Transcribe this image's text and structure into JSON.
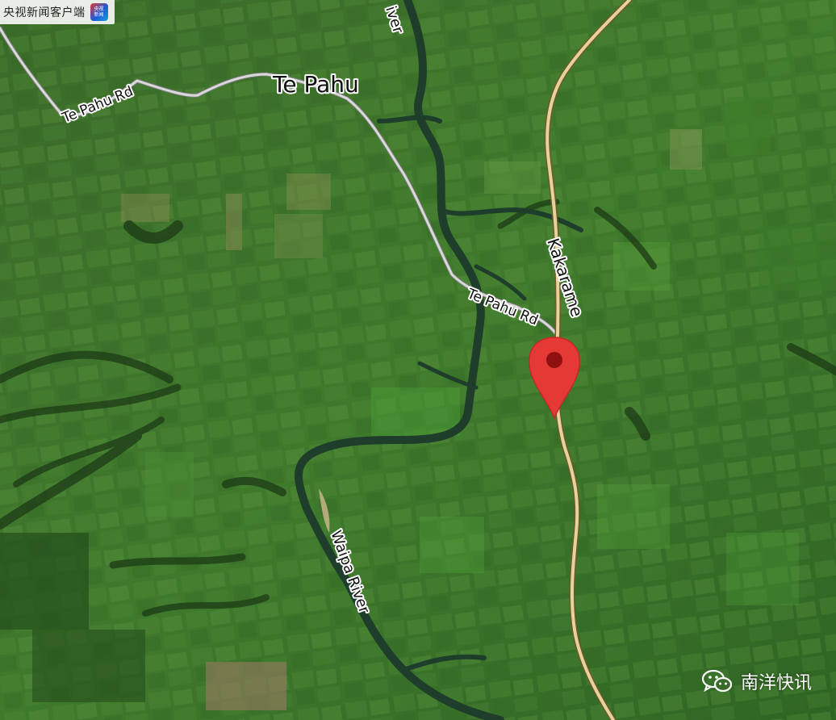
{
  "map": {
    "place_label": "Te Pahu",
    "road_labels": {
      "te_pahu_rd_west": "Te Pahu Rd",
      "te_pahu_rd_east": "Te Pahu Rd",
      "kakaramea_rd": "Kakarame"
    },
    "river_labels": {
      "waipa_river": "Waipa River",
      "river_top_fragment": "iver"
    },
    "marker": {
      "icon": "map-pin-icon",
      "color": "#e53935"
    }
  },
  "watermarks": {
    "cctv_text": "央视新闻客户端",
    "cctv_logo_text": "央视\n新闻",
    "nanyang_text": "南洋快讯",
    "nanyang_icon": "wechat-icon"
  }
}
